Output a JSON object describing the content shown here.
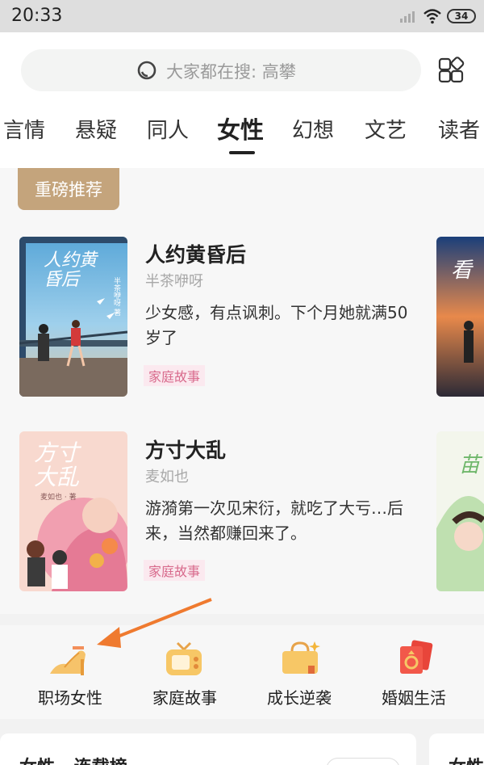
{
  "status_bar": {
    "time": "20:33",
    "battery": "34"
  },
  "search": {
    "placeholder": "大家都在搜: 高攀"
  },
  "tabs": [
    "言情",
    "悬疑",
    "同人",
    "女性",
    "幻想",
    "文艺",
    "读者"
  ],
  "active_tab": "女性",
  "section": {
    "badge": "重磅推荐"
  },
  "books": [
    {
      "title": "人约黄昏后",
      "author": "半茶咿呀",
      "desc": "少女感，有点讽刺。下个月她就满50岁了",
      "tag": "家庭故事",
      "cover_title": "人约黄昏后",
      "cover_author": "半茶咿呀 著"
    },
    {
      "title": "方寸大乱",
      "author": "麦如也",
      "desc": "游漪第一次见宋衍，就吃了大亏…后来，当然都赚回来了。",
      "tag": "家庭故事",
      "cover_title": "方寸大乱",
      "cover_author": "麦如也 · 著"
    }
  ],
  "categories": [
    {
      "label": "职场女性",
      "icon": "high-heel-icon"
    },
    {
      "label": "家庭故事",
      "icon": "tv-icon"
    },
    {
      "label": "成长逆袭",
      "icon": "bag-icon"
    },
    {
      "label": "婚姻生活",
      "icon": "ring-envelope-icon"
    }
  ],
  "bottom": {
    "title": "女性 · 连载榜",
    "title2": "女性"
  },
  "colors": {
    "badge": "#c4a47c",
    "tag_bg": "#fbe9ef",
    "tag_text": "#d86a8c",
    "arrow": "#ef7a2f"
  }
}
